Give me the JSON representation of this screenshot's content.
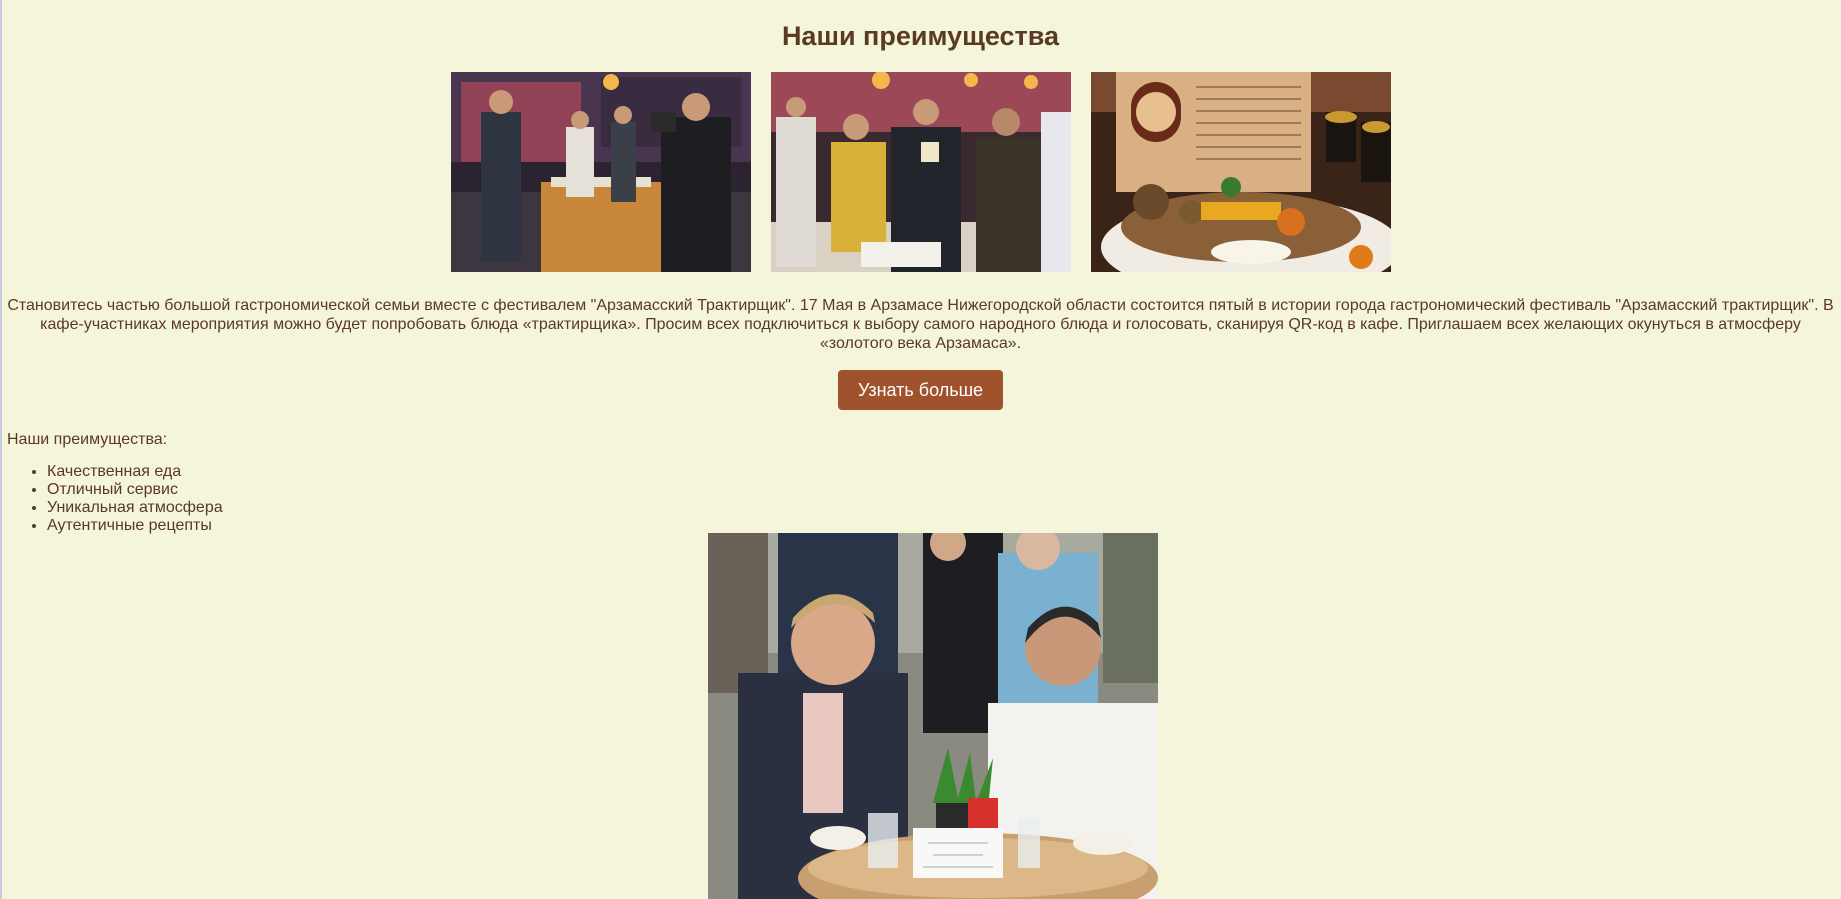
{
  "page": {
    "heading": "Наши преимущества",
    "intro": "Становитесь частью большой гастрономической семьи вместе с фестивалем \"Арзамасский Трактирщик\". 17 Мая в Арзамасе Нижегородской области состоится пятый в истории города гастрономический фестиваль \"Арзамасский трактирщик\". В кафе-участниках мероприятия можно будет попробовать блюда «трактирщика». Просим всех подключиться к выбору самого народного блюда и голосовать, сканируя QR-код в кафе. Приглашаем всех желающих окунуться в атмосферу «золотого века Арзамаса».",
    "cta_label": "Узнать больше",
    "advantages_title": "Наши преимущества:",
    "advantages": [
      "Качественная еда",
      "Отличный сервис",
      "Уникальная атмосфера",
      "Аутентичные рецепты"
    ]
  },
  "colors": {
    "background": "#f5f5dc",
    "text": "#5a3a22",
    "button": "#a0522d",
    "button_text": "#ffffff"
  }
}
